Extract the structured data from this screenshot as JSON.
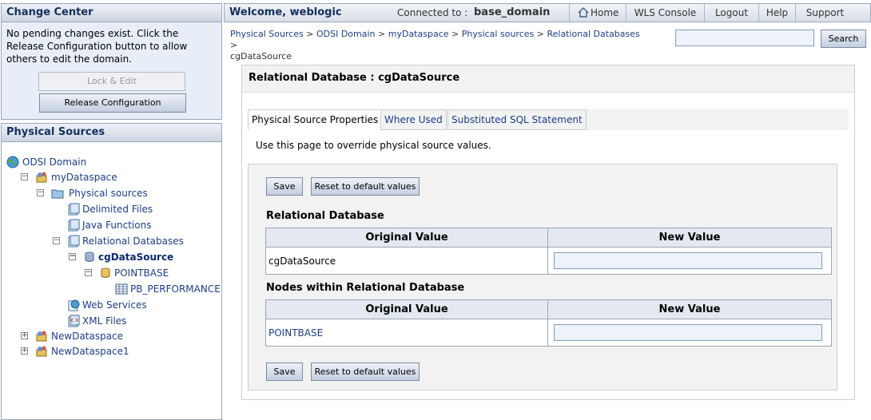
{
  "change_center": {
    "title": "Change Center",
    "message": "No pending changes exist. Click the Release Configuration button to allow others to edit the domain.",
    "lock_label": "Lock & Edit",
    "release_label": "Release Configuration"
  },
  "physical_sources": {
    "title": "Physical Sources",
    "tree": {
      "odsi_domain": "ODSI Domain",
      "my_dataspace": "myDataspace",
      "physical_sources": "Physical sources",
      "delimited_files": "Delimited Files",
      "java_functions": "Java Functions",
      "relational_databases": "Relational Databases",
      "cg_datasource": "cgDataSource",
      "pointbase": "POINTBASE",
      "pb_performance": "PB_PERFORMANCE",
      "web_services": "Web Services",
      "xml_files": "XML Files",
      "new_dataspace": "NewDataspace",
      "new_dataspace1": "NewDataspace1"
    }
  },
  "topbar": {
    "welcome": "Welcome, weblogic",
    "connected_label": "Connected to :",
    "domain": "base_domain",
    "links": {
      "home": "Home",
      "wls_console": "WLS Console",
      "logout": "Logout",
      "help": "Help",
      "support": "Support"
    }
  },
  "breadcrumb": {
    "items": [
      "Physical Sources",
      "ODSI Domain",
      "myDataspace",
      "Physical sources",
      "Relational Databases"
    ],
    "current": "cgDataSource"
  },
  "search": {
    "button_label": "Search",
    "value": ""
  },
  "main": {
    "title": "Relational Database : cgDataSource",
    "tabs": [
      "Physical Source Properties",
      "Where Used",
      "Substituted SQL Statement"
    ],
    "intro": "Use this page to override physical source values.",
    "save_label": "Save",
    "reset_label": "Reset to default values",
    "section1": {
      "heading": "Relational Database",
      "col_original": "Original Value",
      "col_new": "New Value",
      "original": "cgDataSource",
      "new_value": ""
    },
    "section2": {
      "heading": "Nodes within Relational Database",
      "col_original": "Original Value",
      "col_new": "New Value",
      "original": "POINTBASE",
      "new_value": ""
    }
  },
  "colors": {
    "header_text": "#14305c",
    "link": "#1c3d8c",
    "panel_bg": "#e8eef8"
  },
  "icons": [
    "globe-icon",
    "dataspace-icon",
    "folder-icon",
    "file-icon",
    "database-icon",
    "schema-icon",
    "table-icon",
    "home-icon"
  ]
}
